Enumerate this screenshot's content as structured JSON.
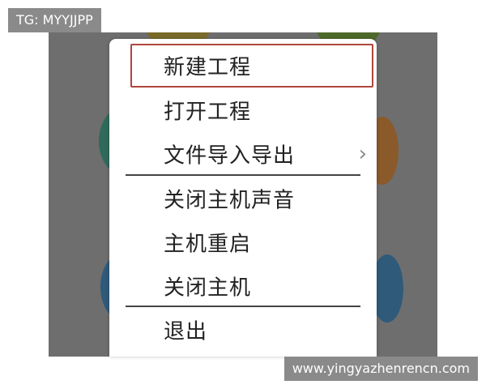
{
  "watermarks": {
    "top_left": "TG: MYYJJPP",
    "bottom_right": "www.yingyazhenrencn.com"
  },
  "menu": {
    "items": [
      {
        "label": "新建工程"
      },
      {
        "label": "打开工程"
      },
      {
        "label": "文件导入导出",
        "submenu_icon": "›"
      },
      {
        "label": "关闭主机声音"
      },
      {
        "label": "主机重启"
      },
      {
        "label": "关闭主机"
      },
      {
        "label": "退出"
      }
    ],
    "highlight_color": "#b0463c"
  },
  "colors": {
    "overlay": "#6e6e6e",
    "menu_background": "#ffffff",
    "text": "#222222"
  },
  "icons": {
    "submenu": "chevron-right-icon"
  }
}
